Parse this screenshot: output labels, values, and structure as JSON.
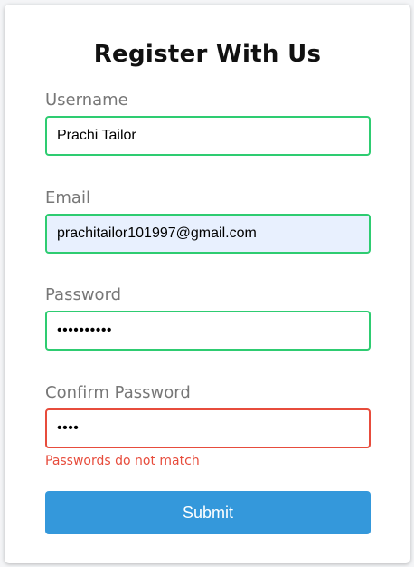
{
  "form": {
    "title": "Register With Us",
    "username": {
      "label": "Username",
      "value": "Prachi Tailor"
    },
    "email": {
      "label": "Email",
      "value": "prachitailor101997@gmail.com"
    },
    "password": {
      "label": "Password",
      "value": "••••••••••"
    },
    "confirm_password": {
      "label": "Confirm Password",
      "value": "••••",
      "error": "Passwords do not match"
    },
    "submit_label": "Submit"
  },
  "colors": {
    "valid_border": "#2ecc71",
    "error_border": "#e74c3c",
    "submit_bg": "#3498db",
    "autofill_bg": "#e8f0fe"
  }
}
